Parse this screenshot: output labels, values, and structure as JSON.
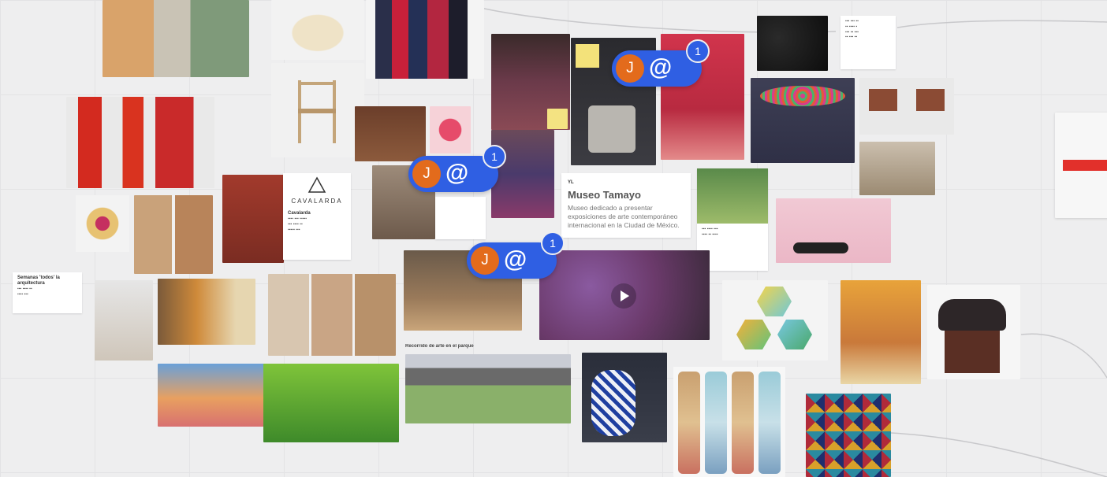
{
  "board": {
    "notes": [
      {
        "title": "Semanas 'todos' la arquitectura",
        "body": ""
      },
      {
        "title": "Cavalarda",
        "body": ""
      }
    ],
    "link_card": {
      "source": "",
      "title": "Museo Tamayo",
      "description": "Museo dedicado a presentar exposiciones de arte contemporáneo internacional en la Ciudad de México."
    },
    "caption_above_photo": "Recorrido de arte en el parque",
    "brand_logo": "CAVALARDA",
    "mentions": [
      {
        "initial": "J",
        "count": "1"
      },
      {
        "initial": "J",
        "count": "1"
      },
      {
        "initial": "J",
        "count": "1"
      }
    ]
  },
  "colors": {
    "canvas": "#eeeeef",
    "mention_blue": "#2f5fe3",
    "avatar_orange": "#e36b1c"
  }
}
